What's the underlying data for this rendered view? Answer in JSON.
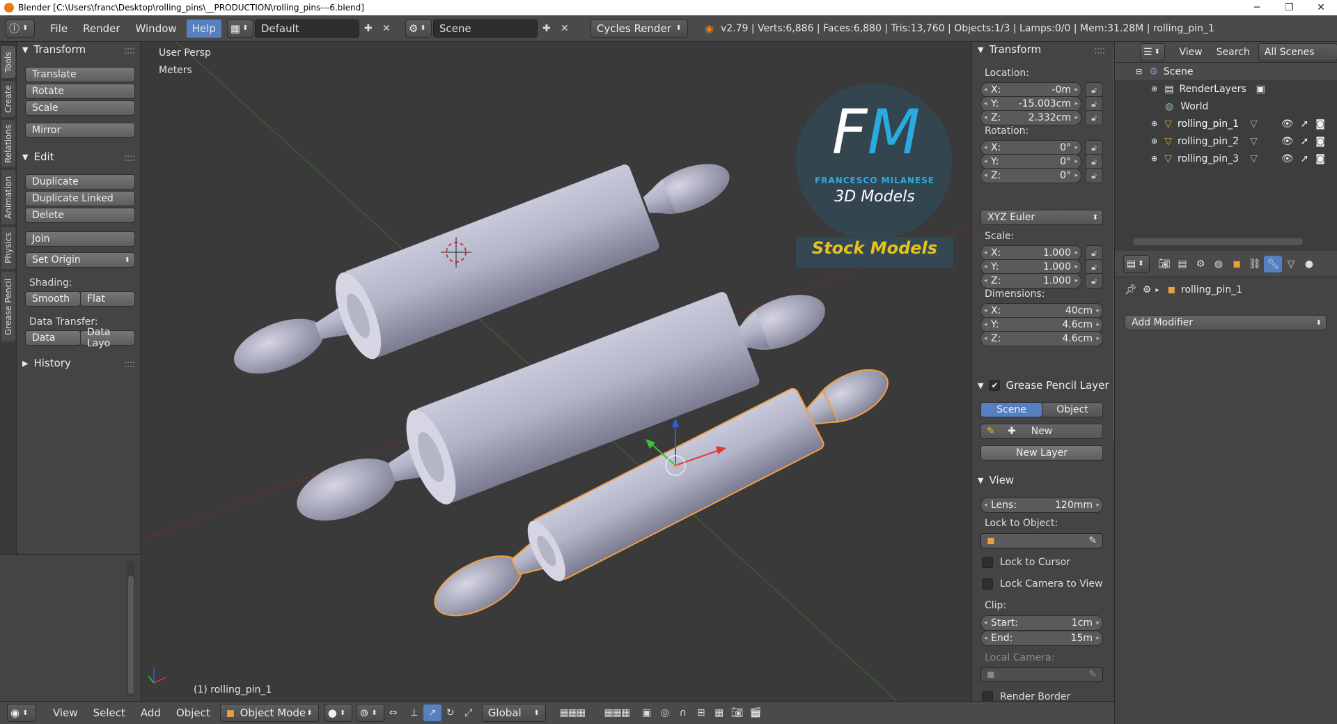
{
  "window": {
    "title": "Blender [C:\\Users\\franc\\Desktop\\rolling_pins\\__PRODUCTION\\rolling_pins---6.blend]",
    "minimize": "─",
    "maximize": "❐",
    "close": "✕"
  },
  "infobar": {
    "menus": [
      "File",
      "Render",
      "Window",
      "Help"
    ],
    "layout": "Default",
    "scene": "Scene",
    "engine": "Cycles Render",
    "stats": "v2.79 | Verts:6,886 | Faces:6,880 | Tris:13,760 | Objects:1/3 | Lamps:0/0 | Mem:31.28M | rolling_pin_1"
  },
  "left_tabs": [
    "Tools",
    "Create",
    "Relations",
    "Animation",
    "Physics",
    "Grease Pencil"
  ],
  "toolshelf": {
    "transform_header": "Transform",
    "translate": "Translate",
    "rotate": "Rotate",
    "scale": "Scale",
    "mirror": "Mirror",
    "edit_header": "Edit",
    "duplicate": "Duplicate",
    "duplicate_linked": "Duplicate Linked",
    "delete": "Delete",
    "join": "Join",
    "set_origin": "Set Origin",
    "shading_label": "Shading:",
    "smooth": "Smooth",
    "flat": "Flat",
    "data_transfer_label": "Data Transfer:",
    "data": "Data",
    "data_layo": "Data Layo",
    "history_header": "History"
  },
  "viewport": {
    "view_name": "User Persp",
    "units": "Meters",
    "object_label": "(1) rolling_pin_1",
    "logo_letters": "FM",
    "logo_name": "FRANCESCO MILANESE",
    "logo_sub": "3D Models",
    "logo_banner": "Stock Models"
  },
  "npanel": {
    "transform_header": "Transform",
    "location_label": "Location:",
    "loc_x": "-0m",
    "loc_y": "-15.003cm",
    "loc_z": "2.332cm",
    "rotation_label": "Rotation:",
    "rot_x": "0°",
    "rot_y": "0°",
    "rot_z": "0°",
    "rotation_mode": "XYZ Euler",
    "scale_label": "Scale:",
    "scale_x": "1.000",
    "scale_y": "1.000",
    "scale_z": "1.000",
    "dimensions_label": "Dimensions:",
    "dim_x": "40cm",
    "dim_y": "4.6cm",
    "dim_z": "4.6cm",
    "gp_header": "Grease Pencil Layer",
    "gp_scene": "Scene",
    "gp_object": "Object",
    "gp_new": "New",
    "gp_new_layer": "New Layer",
    "view_header": "View",
    "lens_key": "Lens:",
    "lens_val": "120mm",
    "lock_object_label": "Lock to Object:",
    "lock_cursor": "Lock to Cursor",
    "lock_camera": "Lock Camera to View",
    "clip_label": "Clip:",
    "clip_start_key": "Start:",
    "clip_start_val": "1cm",
    "clip_end_key": "End:",
    "clip_end_val": "15m",
    "local_camera_label": "Local Camera:",
    "render_border": "Render Border",
    "axis_x": "X:",
    "axis_y": "Y:",
    "axis_z": "Z:"
  },
  "outliner": {
    "view": "View",
    "search": "Search",
    "filter": "All Scenes",
    "items": [
      "Scene",
      "RenderLayers",
      "World",
      "rolling_pin_1",
      "rolling_pin_2",
      "rolling_pin_3"
    ]
  },
  "properties": {
    "object_name": "rolling_pin_1",
    "add_modifier": "Add Modifier"
  },
  "bottombar": {
    "view": "View",
    "select": "Select",
    "add": "Add",
    "object": "Object",
    "mode": "Object Mode",
    "orientation": "Global"
  },
  "colors": {
    "selected_outline": "#f0a040",
    "accent_blue": "#5680c2",
    "logo_blue": "#29abe2",
    "banner_yellow": "#e8c21a"
  }
}
